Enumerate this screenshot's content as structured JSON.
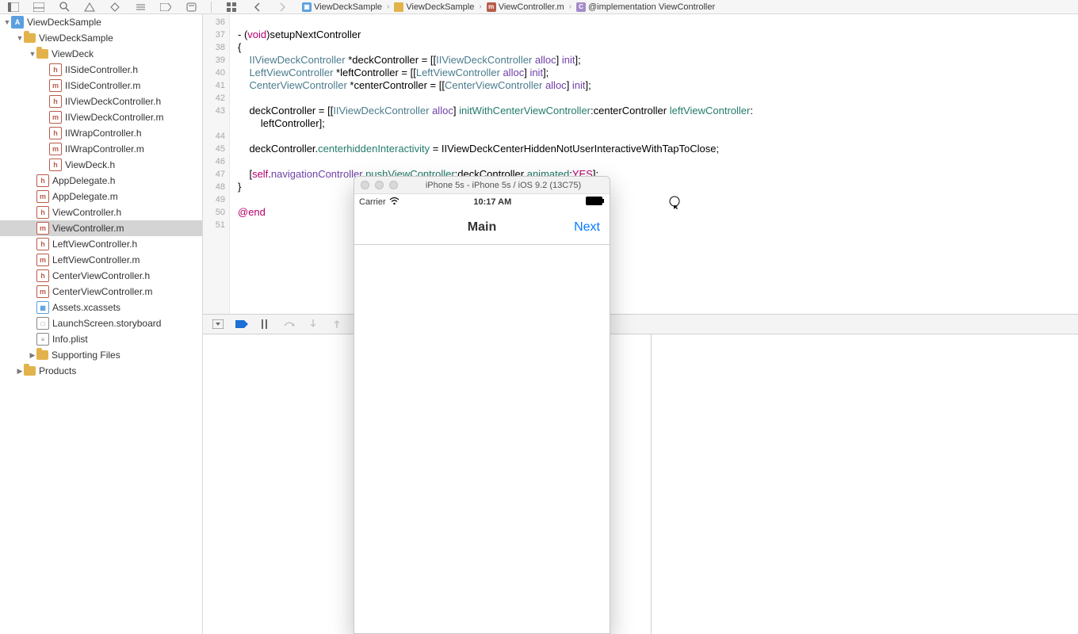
{
  "jump": {
    "segs": [
      {
        "icon": "swift",
        "label": "ViewDeckSample"
      },
      {
        "icon": "folder",
        "label": "ViewDeckSample"
      },
      {
        "icon": "m",
        "label": "ViewController.m"
      },
      {
        "icon": "c",
        "label": "@implementation ViewController"
      }
    ]
  },
  "tree": [
    {
      "d": 0,
      "disc": "open",
      "icon": "proj",
      "t": "A",
      "label": "ViewDeckSample"
    },
    {
      "d": 1,
      "disc": "open",
      "icon": "folder",
      "label": "ViewDeckSample"
    },
    {
      "d": 2,
      "disc": "open",
      "icon": "folder",
      "label": "ViewDeck"
    },
    {
      "d": 3,
      "icon": "h",
      "t": "h",
      "label": "IISideController.h"
    },
    {
      "d": 3,
      "icon": "m",
      "t": "m",
      "label": "IISideController.m"
    },
    {
      "d": 3,
      "icon": "h",
      "t": "h",
      "label": "IIViewDeckController.h"
    },
    {
      "d": 3,
      "icon": "m",
      "t": "m",
      "label": "IIViewDeckController.m"
    },
    {
      "d": 3,
      "icon": "h",
      "t": "h",
      "label": "IIWrapController.h"
    },
    {
      "d": 3,
      "icon": "m",
      "t": "m",
      "label": "IIWrapController.m"
    },
    {
      "d": 3,
      "icon": "h",
      "t": "h",
      "label": "ViewDeck.h"
    },
    {
      "d": 2,
      "icon": "h",
      "t": "h",
      "label": "AppDelegate.h"
    },
    {
      "d": 2,
      "icon": "m",
      "t": "m",
      "label": "AppDelegate.m"
    },
    {
      "d": 2,
      "icon": "h",
      "t": "h",
      "label": "ViewController.h"
    },
    {
      "d": 2,
      "icon": "m",
      "t": "m",
      "label": "ViewController.m",
      "sel": true
    },
    {
      "d": 2,
      "icon": "h",
      "t": "h",
      "label": "LeftViewController.h"
    },
    {
      "d": 2,
      "icon": "m",
      "t": "m",
      "label": "LeftViewController.m"
    },
    {
      "d": 2,
      "icon": "h",
      "t": "h",
      "label": "CenterViewController.h"
    },
    {
      "d": 2,
      "icon": "m",
      "t": "m",
      "label": "CenterViewController.m"
    },
    {
      "d": 2,
      "icon": "asset",
      "t": "▦",
      "label": "Assets.xcassets"
    },
    {
      "d": 2,
      "icon": "sb",
      "t": "□",
      "label": "LaunchScreen.storyboard"
    },
    {
      "d": 2,
      "icon": "plist",
      "t": "≡",
      "label": "Info.plist"
    },
    {
      "d": 2,
      "disc": "closed",
      "icon": "folder",
      "label": "Supporting Files"
    },
    {
      "d": 1,
      "disc": "closed",
      "icon": "folder",
      "label": "Products"
    }
  ],
  "gutter": [
    "36",
    "37",
    "38",
    "39",
    "40",
    "41",
    "42",
    "43",
    "",
    "44",
    "45",
    "46",
    "47",
    "48",
    "49",
    "50",
    "51"
  ],
  "code": {
    "l1a": "- (",
    "l1b": "void",
    "l1c": ")setupNextController",
    "l2": "{",
    "l3a": "    ",
    "l3b": "IIViewDeckController",
    "l3c": " *deckController = [[",
    "l3d": "IIViewDeckController",
    "l3e": " ",
    "l3f": "alloc",
    "l3g": "] ",
    "l3h": "init",
    "l3i": "];",
    "l4a": "    ",
    "l4b": "LeftViewController",
    "l4c": " *leftController = [[",
    "l4d": "LeftViewController",
    "l4e": " ",
    "l4f": "alloc",
    "l4g": "] ",
    "l4h": "init",
    "l4i": "];",
    "l5a": "    ",
    "l5b": "CenterViewController",
    "l5c": " *centerController = [[",
    "l5d": "CenterViewController",
    "l5e": " ",
    "l5f": "alloc",
    "l5g": "] ",
    "l5h": "init",
    "l5i": "];",
    "l6": "    ",
    "l7a": "    deckController = [[",
    "l7b": "IIViewDeckController",
    "l7c": " ",
    "l7d": "alloc",
    "l7e": "] ",
    "l7f": "initWithCenterViewController",
    "l7g": ":centerController ",
    "l7h": "leftViewController",
    "l7i": ":",
    "l7j": "        leftController];",
    "l8": "    ",
    "l9a": "    deckController.",
    "l9b": "centerhiddenInteractivity",
    "l9c": " = IIViewDeckCenterHiddenNotUserInteractiveWithTapToClose;",
    "l10": "    ",
    "l11a": "    [",
    "l11b": "self",
    "l11c": ".",
    "l11d": "navigationController",
    "l11e": " ",
    "l11f": "pushViewController",
    "l11g": ":deckController ",
    "l11h": "animated",
    "l11i": ":",
    "l11j": "YES",
    "l11k": "];",
    "l12": "}",
    "l13": "",
    "l14": "@end"
  },
  "sim": {
    "title": "iPhone 5s - iPhone 5s / iOS 9.2 (13C75)",
    "carrier": "Carrier",
    "time": "10:17 AM",
    "navTitle": "Main",
    "navRight": "Next"
  }
}
